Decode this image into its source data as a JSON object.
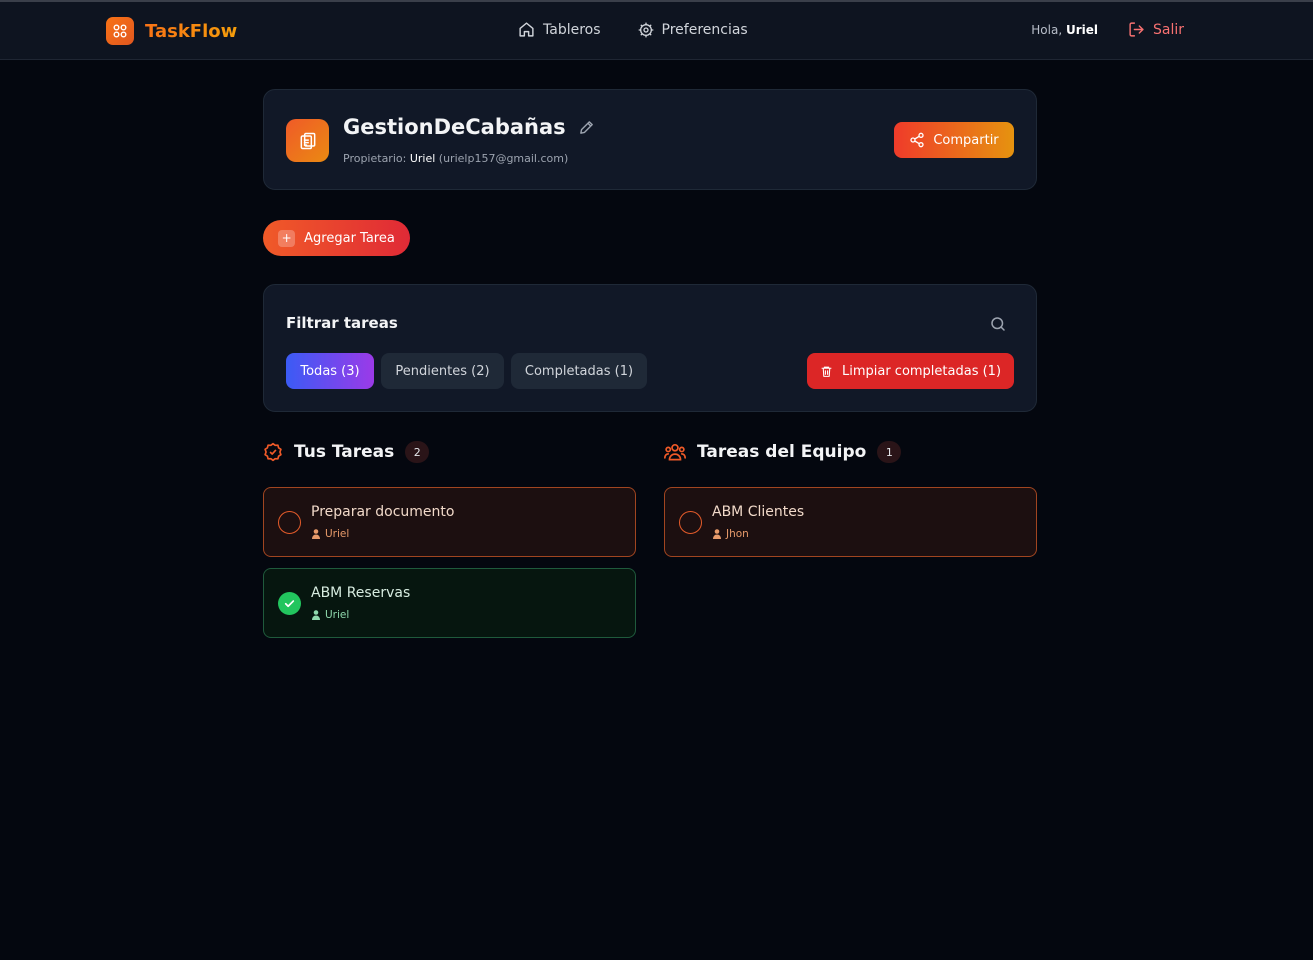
{
  "header": {
    "app_name": "TaskFlow",
    "nav": [
      {
        "label": "Tableros",
        "icon": "home-icon"
      },
      {
        "label": "Preferencias",
        "icon": "gear-icon"
      }
    ],
    "greeting": "Hola,",
    "user_name": "Uriel",
    "logout_label": "Salir"
  },
  "board": {
    "title": "GestionDeCabañas",
    "owner_label": "Propietario:",
    "owner_name": "Uriel",
    "owner_email": "(urielp157@gmail.com)",
    "share_label": "Compartir"
  },
  "actions": {
    "add_task_label": "Agregar Tarea"
  },
  "filter": {
    "title": "Filtrar tareas",
    "chips": [
      "Todas (3)",
      "Pendientes (2)",
      "Completadas (1)"
    ],
    "active_chip": "Todas (3)",
    "clear_label": "Limpiar completadas (1)"
  },
  "my_tasks": {
    "title": "Tus Tareas",
    "count": "2",
    "items": [
      {
        "title": "Preparar documento",
        "user": "Uriel",
        "status": "pending"
      },
      {
        "title": "ABM Reservas",
        "user": "Uriel",
        "status": "done"
      }
    ]
  },
  "team_tasks": {
    "title": "Tareas del Equipo",
    "count": "1",
    "items": [
      {
        "title": "ABM Clientes",
        "user": "Jhon",
        "status": "pending"
      }
    ]
  },
  "colors": {
    "accent_orange": "#f97316",
    "accent_red": "#dc2626",
    "success_green": "#22c55e",
    "active_chip_from": "#3b5bf5",
    "active_chip_to": "#9b3ae8"
  }
}
